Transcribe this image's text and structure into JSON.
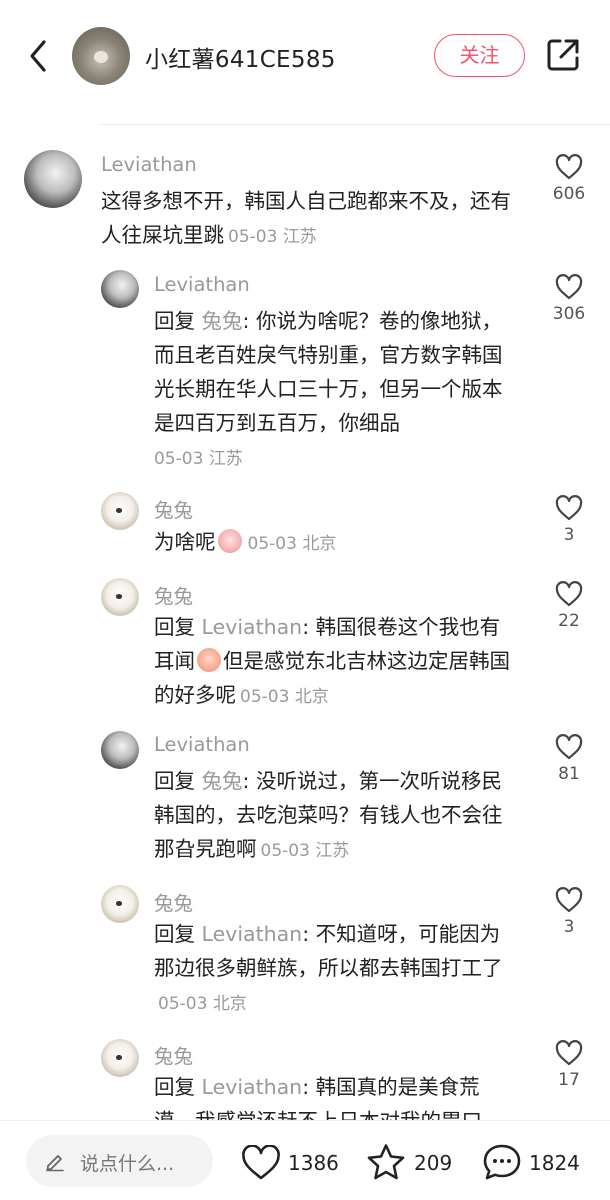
{
  "header": {
    "author_name": "小红薯641CE585",
    "follow_label": "关注"
  },
  "comments": [
    {
      "user": "Leviathan",
      "text": "这得多想不开，韩国人自己跑都来不及，还有人往屎坑里跳",
      "date": "05-03",
      "location": "江苏",
      "likes": "606"
    },
    {
      "user": "Leviathan",
      "reply_prefix": "回复",
      "reply_to": "兔兔",
      "text": "你说为啥呢？卷的像地狱，而且老百姓戾气特别重，官方数字韩国光长期在华人口三十万，但另一个版本是四百万到五百万，你细品",
      "date": "05-03",
      "location": "江苏",
      "likes": "306"
    },
    {
      "user": "兔兔",
      "text": "为啥呢",
      "date": "05-03",
      "location": "北京",
      "likes": "3"
    },
    {
      "user": "兔兔",
      "reply_prefix": "回复",
      "reply_to": "Leviathan",
      "text_a": "韩国很卷这个我也有耳闻",
      "text_b": "但是感觉东北吉林这边定居韩国的好多呢",
      "date": "05-03",
      "location": "北京",
      "likes": "22"
    },
    {
      "user": "Leviathan",
      "reply_prefix": "回复",
      "reply_to": "兔兔",
      "text": "没听说过，第一次听说移民韩国的，去吃泡菜吗？有钱人也不会往那旮旯跑啊",
      "date": "05-03",
      "location": "江苏",
      "likes": "81"
    },
    {
      "user": "兔兔",
      "reply_prefix": "回复",
      "reply_to": "Leviathan",
      "text": "不知道呀，可能因为那边很多朝鲜族，所以都去韩国打工了",
      "date": "05-03",
      "location": "北京",
      "likes": "3"
    },
    {
      "user": "兔兔",
      "reply_prefix": "回复",
      "reply_to": "Leviathan",
      "text": "韩国真的是美食荒漠，我感觉还赶不上日本对我的胃口",
      "likes": "17"
    }
  ],
  "bottom_bar": {
    "input_placeholder": "说点什么...",
    "like_count": "1386",
    "collect_count": "209",
    "comment_count": "1824"
  },
  "colors": {
    "accent": "#f0566e",
    "muted_text": "#999999"
  },
  "icons": [
    "back-arrow-icon",
    "share-icon",
    "heart-icon",
    "star-icon",
    "chat-bubble-icon",
    "pencil-icon"
  ]
}
